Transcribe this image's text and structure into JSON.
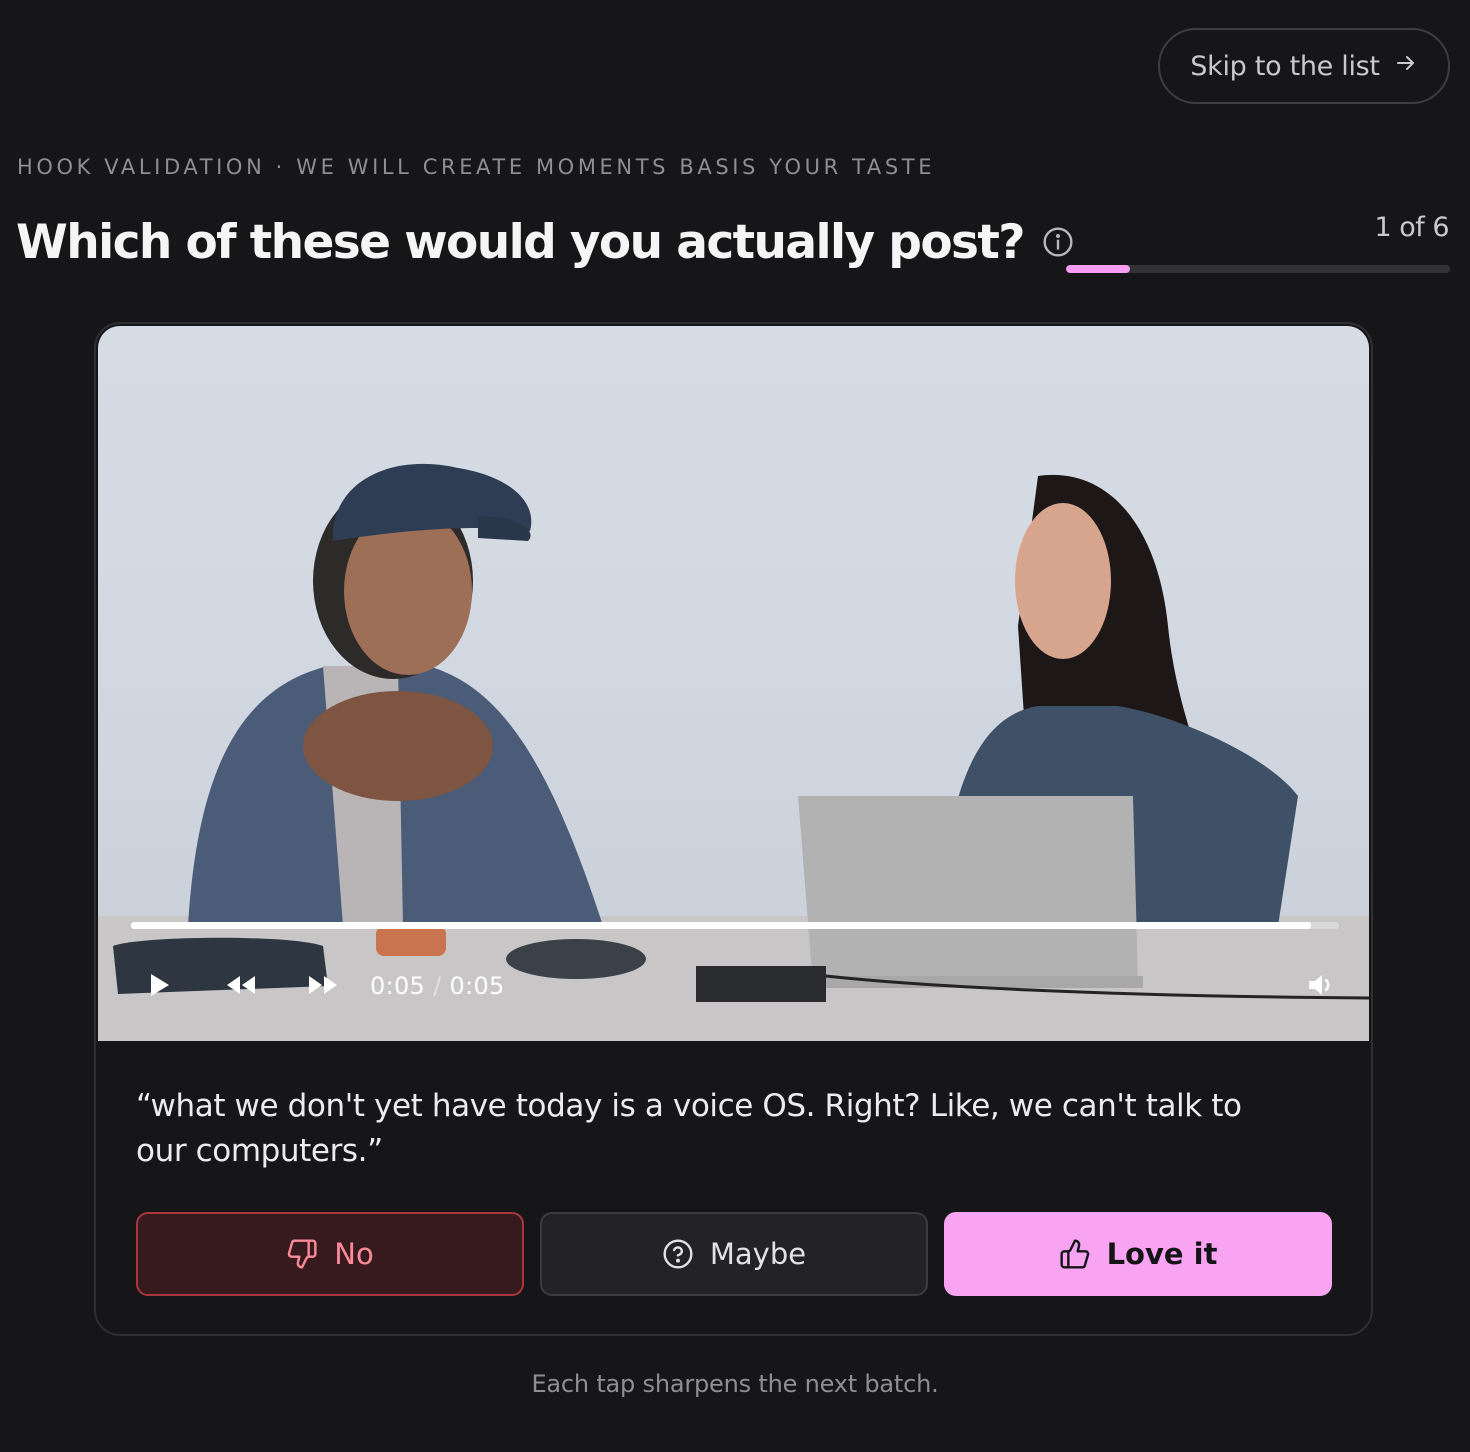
{
  "header": {
    "skip_label": "Skip to the list",
    "eyebrow": "HOOK VALIDATION · WE WILL CREATE MOMENTS BASIS YOUR TASTE",
    "title": "Which of these would you actually post?",
    "progress_label": "1 of 6",
    "progress_fraction": 0.167
  },
  "player": {
    "current_time": "0:05",
    "separator": "/",
    "duration": "0:05",
    "playback_fraction": 0.977
  },
  "clip": {
    "quote": "“what we don't yet have today is a voice OS. Right? Like, we can't talk to our computers.”"
  },
  "actions": {
    "no_label": "No",
    "maybe_label": "Maybe",
    "love_label": "Love it"
  },
  "footer": {
    "note": "Each tap sharpens the next batch."
  },
  "colors": {
    "background": "#161618",
    "accent_pink": "#f9a3f3",
    "no_red": "#a8373f"
  },
  "icons": {
    "skip": "arrow-right-icon",
    "info": "info-icon",
    "no": "thumbs-down-icon",
    "maybe": "question-circle-icon",
    "love": "thumbs-up-icon",
    "play": "play-icon",
    "rewind": "rewind-icon",
    "forward": "fast-forward-icon",
    "volume": "volume-icon"
  }
}
